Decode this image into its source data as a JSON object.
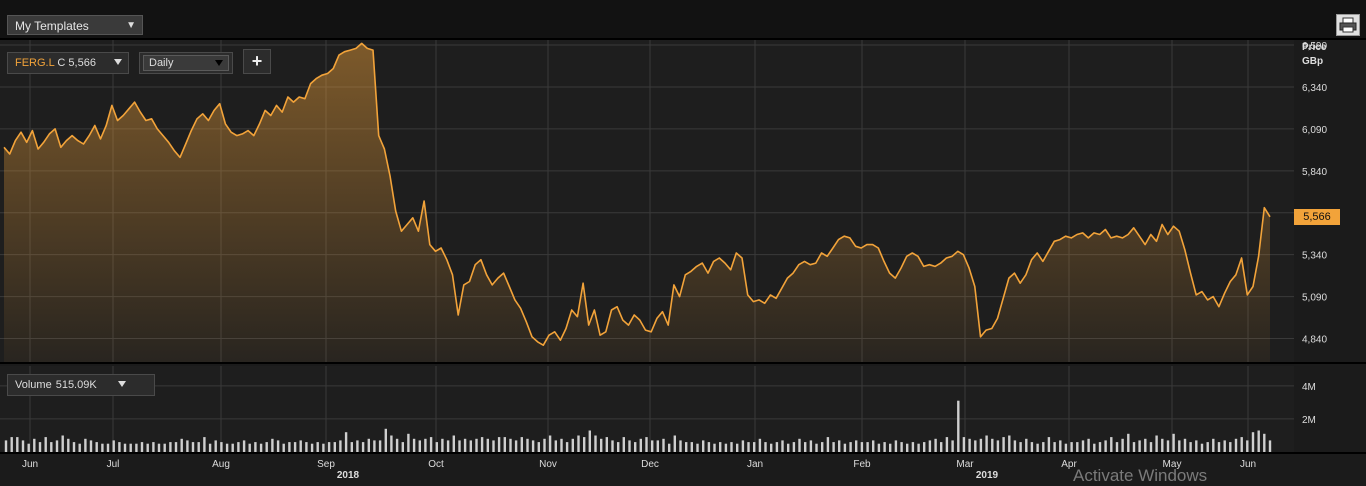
{
  "toolbar": {
    "templates_label": "My Templates",
    "print_icon": "printer-icon"
  },
  "instrument": {
    "ticker": "FERG.L",
    "close_prefix": "C",
    "close_value": "5,566",
    "period": "Daily",
    "add_icon": "+"
  },
  "price_axis": {
    "title": "Price",
    "unit": "GBp",
    "last_label": "5,566"
  },
  "volume_panel": {
    "label": "Volume",
    "value": "515.09K"
  },
  "colors": {
    "line": "#f2a33a",
    "background": "#1b1b1b",
    "grid": "#3a3a3a",
    "volume_bar": "#cfcfcf"
  },
  "watermark": "Activate Windows",
  "chart_data": {
    "type": "area",
    "title": "",
    "ylabel": "Price GBp",
    "ylim": [
      4700,
      6620
    ],
    "yticks": [
      4840,
      5090,
      5340,
      5590,
      5840,
      6090,
      6340,
      6590
    ],
    "ytick_labels": [
      "4,840",
      "5,090",
      "5,340",
      "",
      "5,840",
      "6,090",
      "6,340",
      "6,590"
    ],
    "xticks": [
      "Jun",
      "Jul",
      "Aug",
      "Sep",
      "Oct",
      "Nov",
      "Dec",
      "Jan",
      "Feb",
      "Mar",
      "Apr",
      "May",
      "Jun"
    ],
    "year_labels": [
      {
        "after_tick": "Sep",
        "label": "2018"
      },
      {
        "after_tick": "Mar",
        "label": "2019"
      }
    ],
    "series": [
      {
        "values": [
          5980,
          5940,
          6020,
          6070,
          6010,
          6080,
          5970,
          6010,
          6060,
          6090,
          5980,
          6020,
          6050,
          6020,
          6000,
          6050,
          6110,
          6030,
          6110,
          6230,
          6140,
          6170,
          6210,
          6250,
          6190,
          6140,
          6150,
          6090,
          6050,
          6010,
          5960,
          5920,
          6000,
          6080,
          6150,
          6180,
          6140,
          6200,
          6240,
          6120,
          6070,
          6050,
          6060,
          6080,
          6050,
          6120,
          6200,
          6170,
          6230,
          6190,
          6280,
          6250,
          6280,
          6270,
          6360,
          6390,
          6410,
          6420,
          6450,
          6530,
          6550,
          6560,
          6570,
          6600,
          6570,
          6560,
          6050,
          5970,
          5810,
          5600,
          5480,
          5520,
          5560,
          5480,
          5660,
          5400,
          5360,
          5380,
          5310,
          5220,
          4980,
          5160,
          5180,
          5280,
          5310,
          5220,
          5160,
          5200,
          5230,
          5150,
          5070,
          5020,
          4940,
          4850,
          4820,
          4800,
          4860,
          4880,
          4830,
          4900,
          5010,
          4970,
          5170,
          4920,
          5010,
          4860,
          4880,
          5010,
          5030,
          4950,
          4920,
          4980,
          4950,
          4890,
          4880,
          4960,
          5000,
          4920,
          5160,
          5090,
          5220,
          5240,
          5270,
          5290,
          5230,
          5300,
          5320,
          5290,
          5250,
          5350,
          5320,
          5100,
          5060,
          5070,
          5050,
          5100,
          5080,
          5140,
          5200,
          5230,
          5280,
          5300,
          5280,
          5290,
          5350,
          5330,
          5380,
          5430,
          5450,
          5440,
          5390,
          5380,
          5400,
          5400,
          5380,
          5300,
          5230,
          5200,
          5260,
          5330,
          5350,
          5330,
          5270,
          5280,
          5270,
          5290,
          5320,
          5330,
          5360,
          5340,
          5260,
          5150,
          4850,
          4890,
          4900,
          4960,
          5080,
          5200,
          5230,
          5170,
          5220,
          5310,
          5350,
          5300,
          5360,
          5420,
          5430,
          5450,
          5440,
          5460,
          5470,
          5440,
          5470,
          5460,
          5490,
          5440,
          5450,
          5440,
          5460,
          5500,
          5450,
          5400,
          5460,
          5420,
          5520,
          5460,
          5510,
          5480,
          5370,
          5230,
          5100,
          5120,
          5070,
          5090,
          5030,
          5110,
          5180,
          5220,
          5320,
          5100,
          5150,
          5330,
          5620,
          5566
        ]
      }
    ],
    "volume": {
      "ylim": [
        0,
        5.2
      ],
      "yticks": [
        2,
        4
      ],
      "ytick_labels": [
        "2M",
        "4M"
      ],
      "values": [
        0.7,
        0.9,
        0.9,
        0.7,
        0.5,
        0.8,
        0.6,
        0.9,
        0.6,
        0.7,
        1.0,
        0.8,
        0.6,
        0.5,
        0.8,
        0.7,
        0.6,
        0.5,
        0.5,
        0.7,
        0.6,
        0.5,
        0.5,
        0.5,
        0.6,
        0.5,
        0.6,
        0.5,
        0.5,
        0.6,
        0.6,
        0.8,
        0.7,
        0.6,
        0.6,
        0.9,
        0.5,
        0.7,
        0.6,
        0.5,
        0.5,
        0.6,
        0.7,
        0.5,
        0.6,
        0.5,
        0.6,
        0.8,
        0.7,
        0.5,
        0.6,
        0.6,
        0.7,
        0.6,
        0.5,
        0.6,
        0.5,
        0.6,
        0.6,
        0.7,
        1.2,
        0.6,
        0.7,
        0.6,
        0.8,
        0.7,
        0.7,
        1.4,
        1.0,
        0.8,
        0.6,
        1.1,
        0.8,
        0.7,
        0.8,
        0.9,
        0.6,
        0.8,
        0.7,
        1.0,
        0.7,
        0.8,
        0.7,
        0.8,
        0.9,
        0.8,
        0.7,
        0.9,
        0.9,
        0.8,
        0.7,
        0.9,
        0.8,
        0.7,
        0.6,
        0.8,
        1.0,
        0.7,
        0.8,
        0.6,
        0.8,
        1.0,
        0.9,
        1.3,
        1.0,
        0.8,
        0.9,
        0.7,
        0.6,
        0.9,
        0.7,
        0.6,
        0.8,
        0.9,
        0.7,
        0.7,
        0.8,
        0.5,
        1.0,
        0.7,
        0.6,
        0.6,
        0.5,
        0.7,
        0.6,
        0.5,
        0.6,
        0.5,
        0.6,
        0.5,
        0.7,
        0.6,
        0.6,
        0.8,
        0.6,
        0.5,
        0.6,
        0.7,
        0.5,
        0.6,
        0.8,
        0.6,
        0.7,
        0.5,
        0.6,
        0.9,
        0.6,
        0.7,
        0.5,
        0.6,
        0.7,
        0.6,
        0.6,
        0.7,
        0.5,
        0.6,
        0.5,
        0.7,
        0.6,
        0.5,
        0.6,
        0.5,
        0.6,
        0.7,
        0.8,
        0.6,
        0.9,
        0.7,
        3.1,
        0.9,
        0.8,
        0.7,
        0.8,
        1.0,
        0.8,
        0.7,
        0.9,
        1.0,
        0.7,
        0.6,
        0.8,
        0.6,
        0.5,
        0.6,
        0.9,
        0.6,
        0.7,
        0.5,
        0.6,
        0.6,
        0.7,
        0.8,
        0.5,
        0.6,
        0.7,
        0.9,
        0.6,
        0.8,
        1.1,
        0.6,
        0.7,
        0.8,
        0.6,
        1.0,
        0.8,
        0.7,
        1.1,
        0.7,
        0.8,
        0.6,
        0.7,
        0.5,
        0.6,
        0.8,
        0.6,
        0.7,
        0.6,
        0.8,
        0.9,
        0.7,
        1.2,
        1.3,
        1.1,
        0.7
      ]
    }
  }
}
